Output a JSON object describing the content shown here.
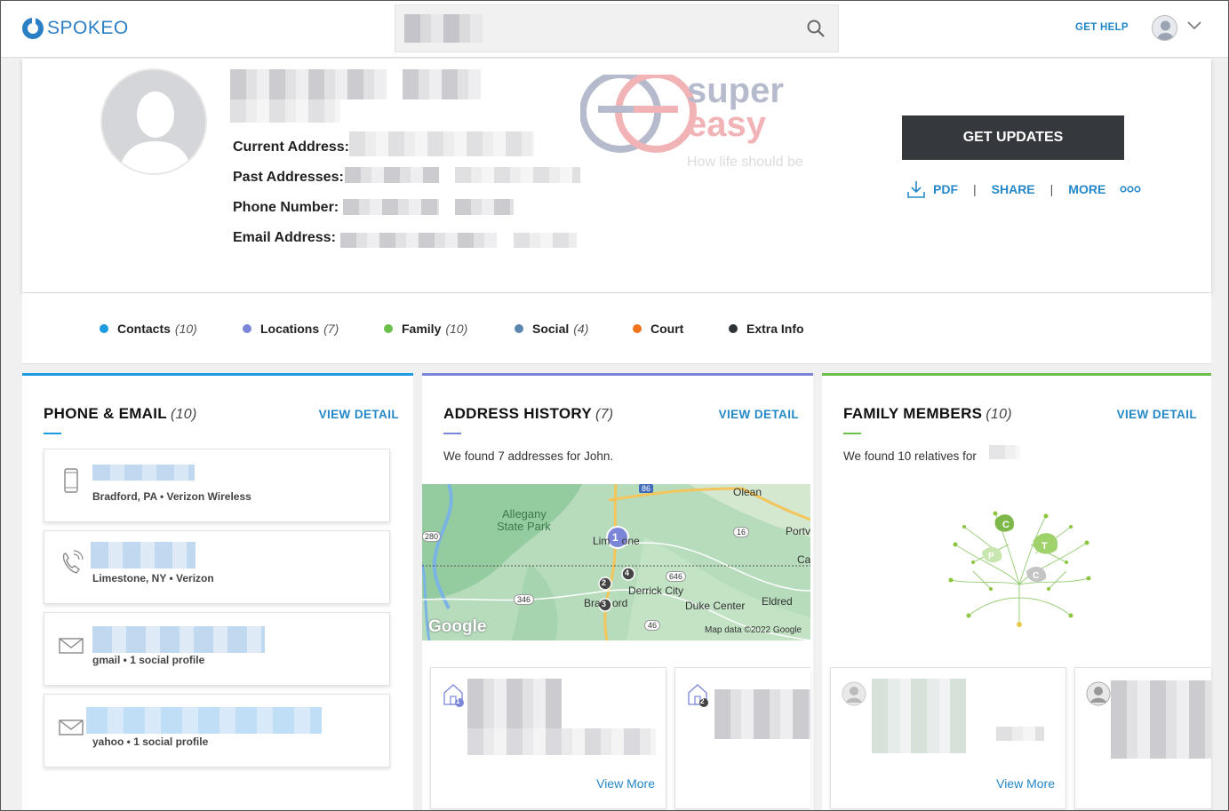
{
  "header": {
    "logo_text": "SPOKEO",
    "search_placeholder": "",
    "help_label": "GET HELP"
  },
  "profile": {
    "current_address_label": "Current Address:",
    "past_addresses_label": "Past Addresses:",
    "phone_label": "Phone Number:",
    "email_label": "Email Address:",
    "watermark_line1": "super",
    "watermark_line2": "easy",
    "watermark_tagline": "How life should be",
    "updates_button": "GET UPDATES",
    "pdf_label": "PDF",
    "share_label": "SHARE",
    "more_label": "MORE",
    "separator": "|"
  },
  "tabs": [
    {
      "label": "Contacts",
      "count": "(10)",
      "color": "#1c9be0"
    },
    {
      "label": "Locations",
      "count": "(7)",
      "color": "#7b86d9"
    },
    {
      "label": "Family",
      "count": "(10)",
      "color": "#6cc04a"
    },
    {
      "label": "Social",
      "count": "(4)",
      "color": "#5a86b0"
    },
    {
      "label": "Court",
      "count": "",
      "color": "#f0731c"
    },
    {
      "label": "Extra Info",
      "count": "",
      "color": "#2e3337"
    }
  ],
  "phone_email": {
    "title": "PHONE & EMAIL",
    "count": "(10)",
    "view_detail": "VIEW DETAIL",
    "accent": "#1c9be0",
    "items": [
      {
        "icon": "mobile-phone-icon",
        "sub": "Bradford, PA • Verizon Wireless"
      },
      {
        "icon": "landline-phone-icon",
        "sub": "Limestone, NY • Verizon"
      },
      {
        "icon": "email-envelope-icon",
        "sub": "gmail • 1 social profile"
      },
      {
        "icon": "email-envelope-icon",
        "sub": "yahoo • 1 social profile"
      }
    ]
  },
  "address_history": {
    "title": "ADDRESS HISTORY",
    "count": "(7)",
    "view_detail": "VIEW DETAIL",
    "accent": "#7b86d9",
    "intro": "We found 7 addresses for John.",
    "map": {
      "labels": {
        "park_1": "Allegany",
        "park_2": "State Park",
        "olean": "Olean",
        "portv": "Portv",
        "ca": "Ca",
        "limestone": "Lim    one",
        "derrick": "Derrick City",
        "bradford": "Bra    ord",
        "duke": "Duke Center",
        "eldred": "Eldred",
        "google": "Google",
        "mapdata": "Map data ©2022 Google"
      },
      "routes": [
        "86",
        "16",
        "646",
        "346",
        "46",
        "280"
      ],
      "markers": [
        "1",
        "2",
        "3",
        "4"
      ]
    },
    "cards": [
      {
        "badge": "1",
        "view_more": "View More"
      },
      {
        "badge": "2",
        "view_more": ""
      }
    ]
  },
  "family_members": {
    "title": "FAMILY MEMBERS",
    "count": "(10)",
    "view_detail": "VIEW DETAIL",
    "accent": "#6cc04a",
    "intro": "We found 10 relatives for",
    "tree_leaves": [
      "C",
      "T",
      "P",
      "C"
    ],
    "cards": [
      {
        "view_more": "View More"
      },
      {
        "view_more": ""
      }
    ]
  }
}
